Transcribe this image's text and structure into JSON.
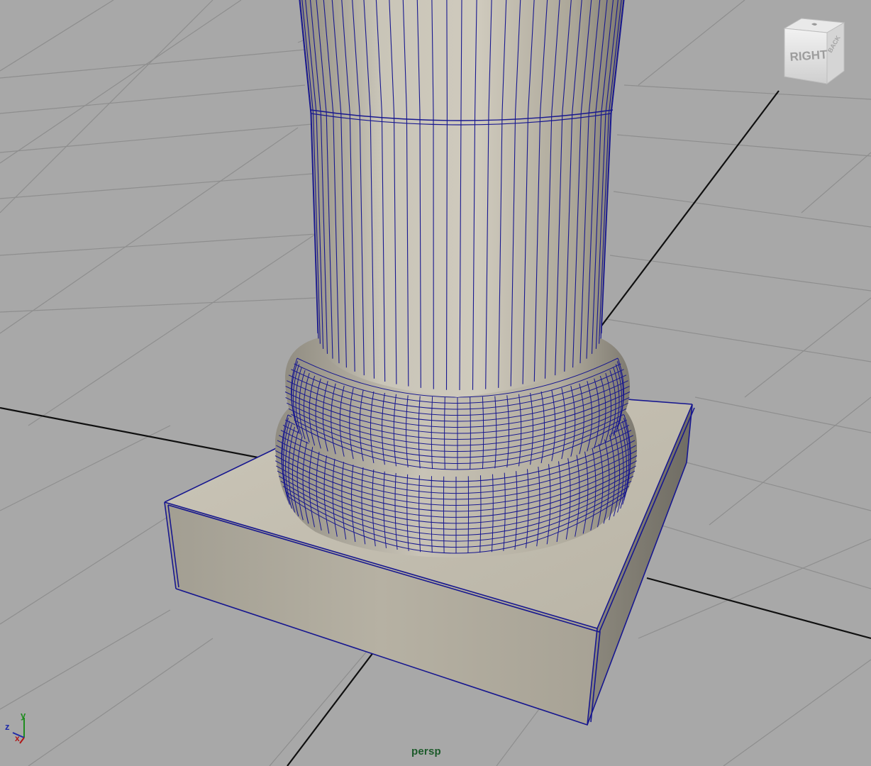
{
  "viewport": {
    "camera_label": "persp"
  },
  "viewcube": {
    "front_face_label": "RIGHT",
    "side_face_label": "BACK",
    "icon": "view-cube-icon"
  },
  "axis_indicator": {
    "z_label": "z",
    "y_label": "y",
    "x_label": "x",
    "icon": "axis-gizmo-icon"
  },
  "colors": {
    "viewport_background": "#a8a8a8",
    "grid_line": "#8e8e8e",
    "grid_axis_line": "#101010",
    "wireframe": "#17178f",
    "stone": "#b8b3a6",
    "camera_label": "#1c5a2a"
  },
  "scene": {
    "object": "column-base",
    "display_mode": "wireframe-on-shaded"
  }
}
